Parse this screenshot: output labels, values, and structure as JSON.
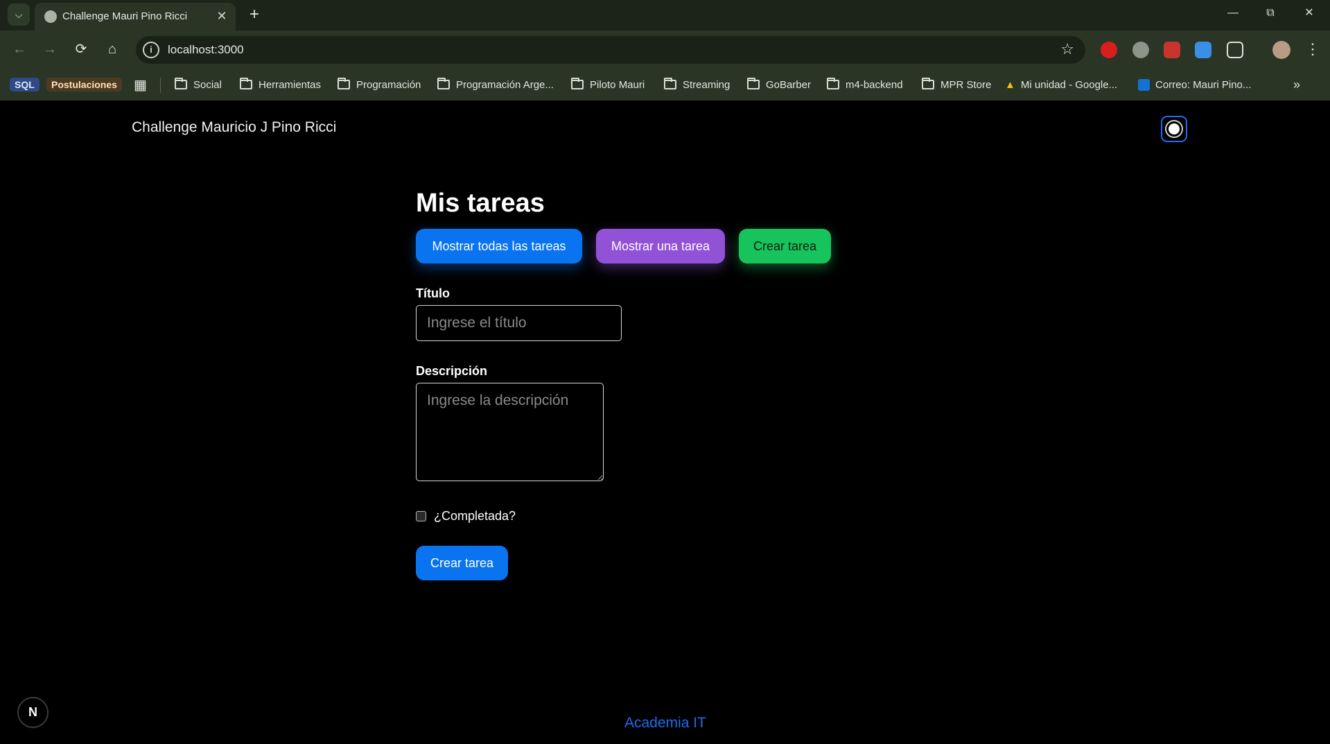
{
  "browser": {
    "tab_title": "Challenge Mauri Pino Ricci",
    "url": "localhost:3000",
    "bookmarks": [
      {
        "label": "SQL",
        "kind": "chip",
        "color": "#2f4a86"
      },
      {
        "label": "Postulaciones",
        "kind": "chip",
        "color": "#4d3a22"
      },
      {
        "label": "Social",
        "kind": "folder"
      },
      {
        "label": "Herramientas",
        "kind": "folder"
      },
      {
        "label": "Programación",
        "kind": "folder"
      },
      {
        "label": "Programación Arge...",
        "kind": "folder"
      },
      {
        "label": "Piloto Mauri",
        "kind": "folder"
      },
      {
        "label": "Streaming",
        "kind": "folder"
      },
      {
        "label": "GoBarber",
        "kind": "folder"
      },
      {
        "label": "m4-backend",
        "kind": "folder"
      },
      {
        "label": "MPR Store",
        "kind": "folder"
      },
      {
        "label": "Mi unidad - Google...",
        "kind": "drive"
      },
      {
        "label": "Correo: Mauri Pino...",
        "kind": "outlook"
      }
    ]
  },
  "header": {
    "brand": "Challenge Mauricio J Pino Ricci"
  },
  "main": {
    "heading": "Mis tareas",
    "buttons": {
      "show_all": "Mostrar todas las tareas",
      "show_one": "Mostrar una tarea",
      "create": "Crear tarea"
    },
    "form": {
      "title_label": "Título",
      "title_placeholder": "Ingrese el título",
      "description_label": "Descripción",
      "description_placeholder": "Ingrese la descripción",
      "completed_label": "¿Completada?",
      "submit_label": "Crear tarea"
    }
  },
  "footer": {
    "link": "Academia IT"
  },
  "colors": {
    "accent_blue": "#0a74f0",
    "purple": "#9152d8",
    "green": "#17c45c"
  }
}
